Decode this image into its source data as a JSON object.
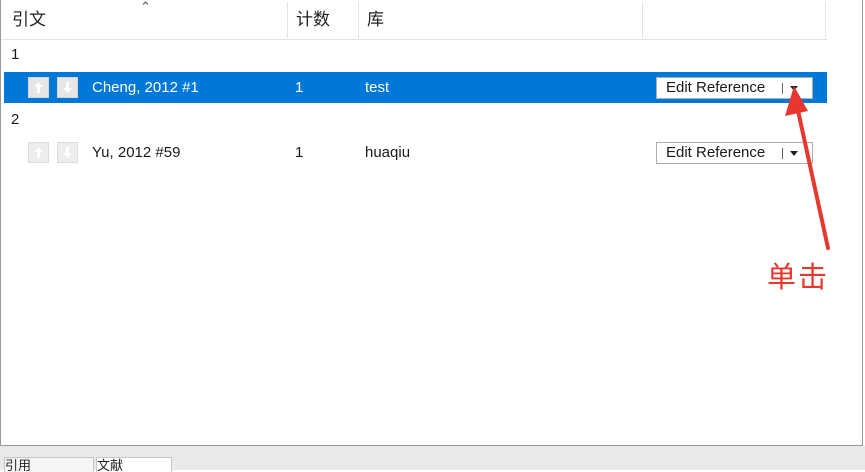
{
  "columns": {
    "citation": "引文",
    "count": "计数",
    "library": "库"
  },
  "groups": [
    {
      "label": "1",
      "citation": "Cheng, 2012 #1",
      "count": "1",
      "library": "test",
      "button_label": "Edit Reference",
      "selected": true
    },
    {
      "label": "2",
      "citation": "Yu, 2012 #59",
      "count": "1",
      "library": "huaqiu",
      "button_label": "Edit Reference",
      "selected": false
    }
  ],
  "annotation": {
    "text": "单击",
    "color": "#e8372c"
  },
  "bottom_tabs": [
    "引用",
    "文献"
  ],
  "icons": {
    "sort": "sort-ascending-icon",
    "move_up": "arrow-up-icon",
    "move_down": "arrow-down-icon",
    "dropdown": "chevron-down-icon"
  },
  "colors": {
    "selection": "#0078d7",
    "annotation": "#e8372c"
  }
}
